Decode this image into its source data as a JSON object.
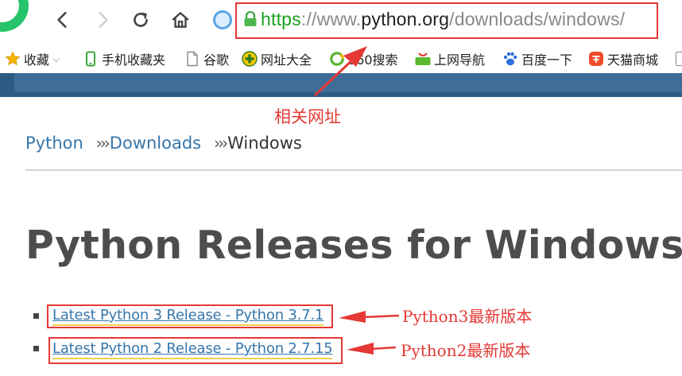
{
  "browser": {
    "url": {
      "scheme": "https",
      "sep": "://www.",
      "host": "python.org",
      "path": "/downloads/windows/"
    },
    "icons": [
      "back-icon",
      "forward-icon",
      "reload-icon",
      "home-icon",
      "lock-icon"
    ]
  },
  "bookmarks": [
    {
      "label": "收藏",
      "icon": "star-icon"
    },
    {
      "label": "手机收藏夹",
      "icon": "phone-icon"
    },
    {
      "label": "谷歌",
      "icon": "page-icon"
    },
    {
      "label": "网址大全",
      "icon": "plus-icon"
    },
    {
      "label": "360搜索",
      "icon": "ring-icon"
    },
    {
      "label": "上网导航",
      "icon": "hao-icon"
    },
    {
      "label": "百度一下",
      "icon": "paw-icon"
    },
    {
      "label": "天猫商城",
      "icon": "tmall-icon"
    }
  ],
  "page": {
    "breadcrumb": [
      {
        "label": "Python"
      },
      {
        "label": "Downloads"
      },
      {
        "label": "Windows"
      }
    ],
    "breadcrumb_sep": "›››",
    "title": "Python Releases for Windows",
    "links": [
      {
        "label": "Latest Python 3 Release - Python 3.7.1"
      },
      {
        "label": "Latest Python 2 Release - Python 2.7.15"
      }
    ]
  },
  "annotations": {
    "url_note": "相关网址",
    "py3_note": "Python3最新版本",
    "py2_note": "Python2最新版本"
  },
  "colors": {
    "annotation": "#e53935",
    "link": "#3776ab",
    "header": "#2b5b84",
    "secure": "#1aa11f"
  }
}
